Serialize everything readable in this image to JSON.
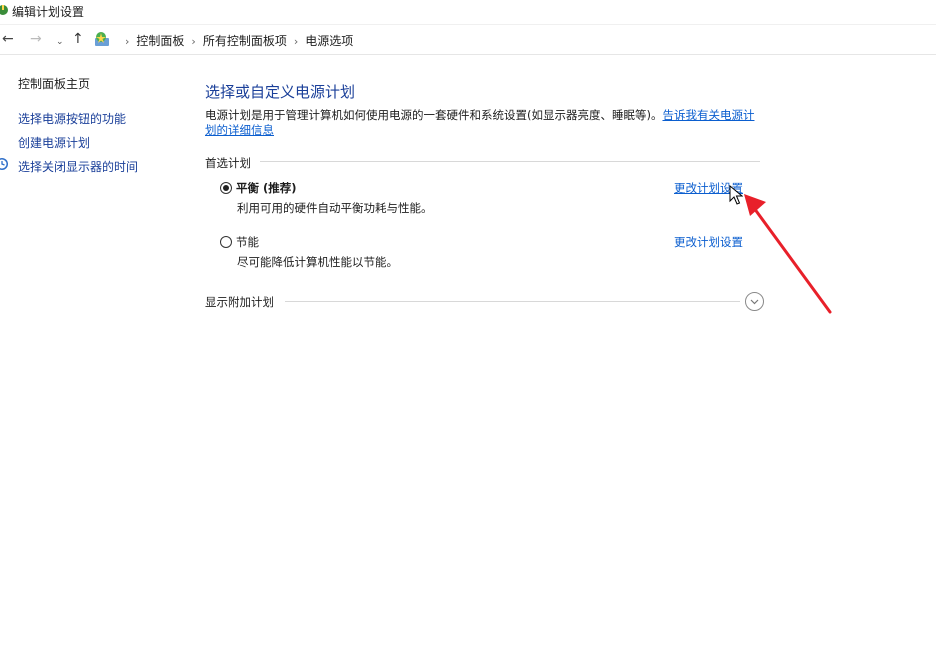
{
  "window": {
    "title": "编辑计划设置"
  },
  "nav": {
    "back": "←",
    "forward": "→",
    "recent": "⌄",
    "up": "↑",
    "breadcrumbs": [
      "控制面板",
      "所有控制面板项",
      "电源选项"
    ],
    "separator": "›"
  },
  "sidebar": {
    "home": "控制面板主页",
    "items": [
      "选择电源按钮的功能",
      "创建电源计划",
      "选择关闭显示器的时间"
    ]
  },
  "main": {
    "title": "选择或自定义电源计划",
    "description": "电源计划是用于管理计算机如何使用电源的一套硬件和系统设置(如显示器亮度、睡眠等)。",
    "description_link": "告诉我有关电源计划的详细信息",
    "preferred_label": "首选计划",
    "plans": [
      {
        "name": "平衡 (推荐)",
        "desc": "利用可用的硬件自动平衡功耗与性能。",
        "link": "更改计划设置",
        "selected": true
      },
      {
        "name": "节能",
        "desc": "尽可能降低计算机性能以节能。",
        "link": "更改计划设置",
        "selected": false
      }
    ],
    "show_more_label": "显示附加计划"
  },
  "colors": {
    "link": "#0b5ecf",
    "title": "#1a3f99",
    "annotation_arrow": "#e8202a"
  }
}
